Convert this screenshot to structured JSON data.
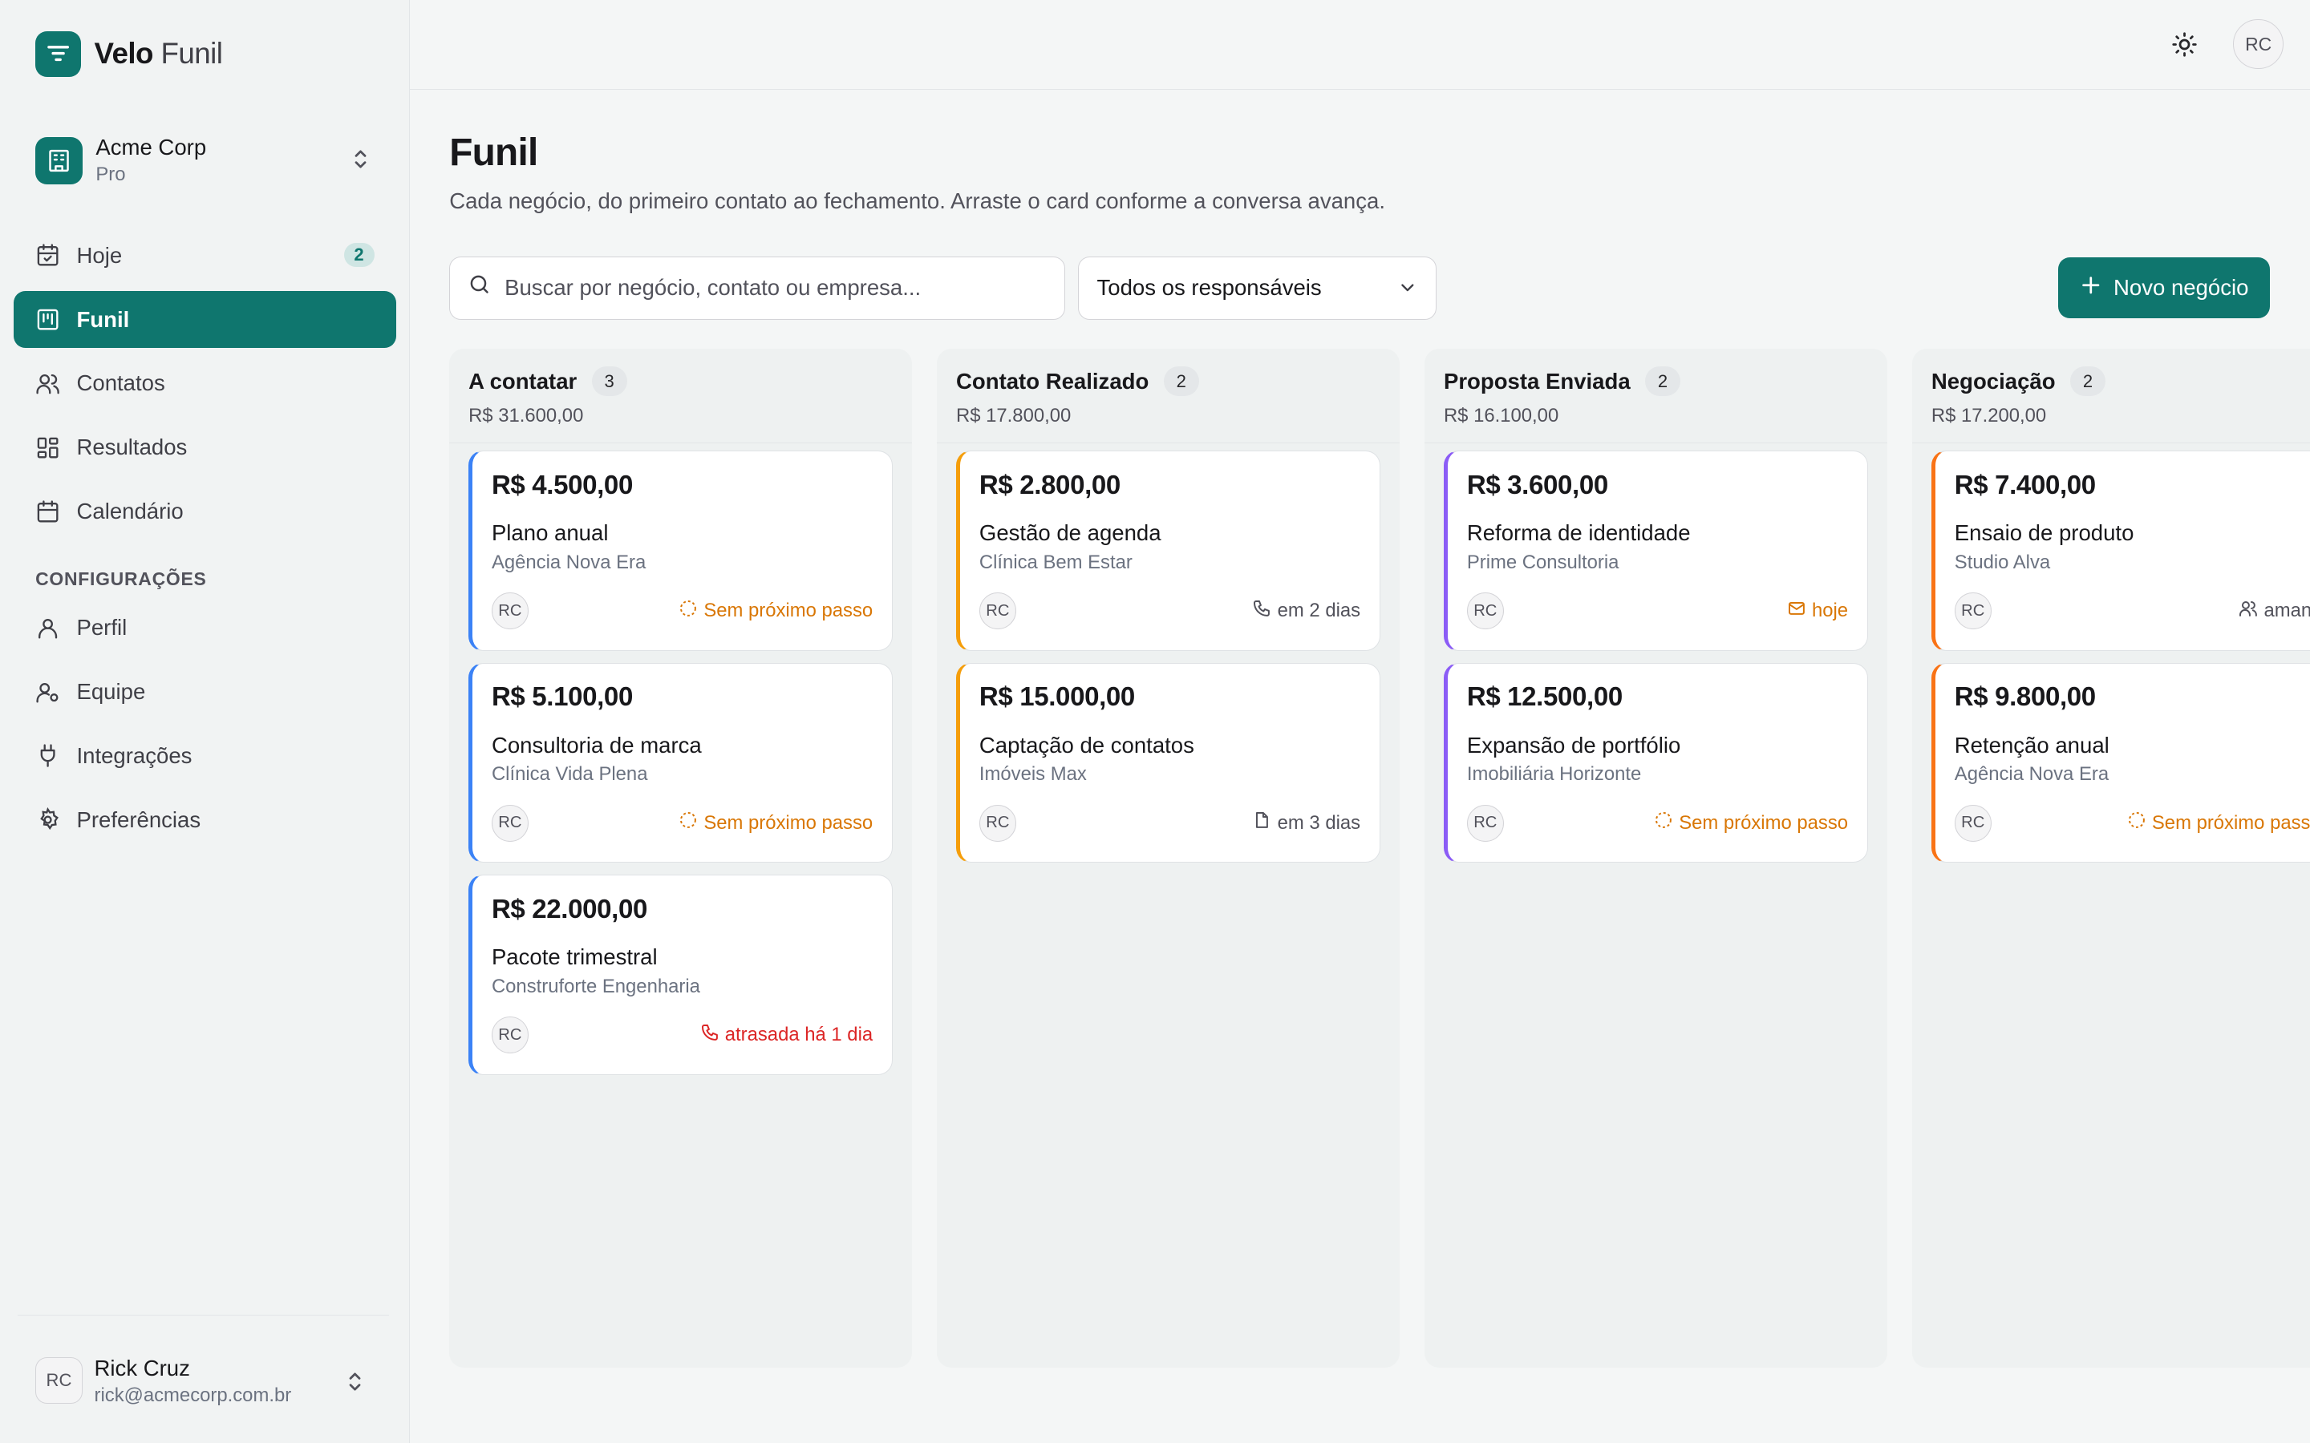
{
  "app": {
    "name_bold": "Velo",
    "name_light": "Funil"
  },
  "org": {
    "name": "Acme Corp",
    "plan": "Pro"
  },
  "nav": [
    {
      "label": "Hoje",
      "icon": "calendar-check-icon",
      "badge": "2"
    },
    {
      "label": "Funil",
      "icon": "kanban-icon",
      "active": true
    },
    {
      "label": "Contatos",
      "icon": "users-icon"
    },
    {
      "label": "Resultados",
      "icon": "dashboard-icon"
    },
    {
      "label": "Calendário",
      "icon": "calendar-icon"
    }
  ],
  "settings": {
    "label": "CONFIGURAÇÕES",
    "items": [
      {
        "label": "Perfil",
        "icon": "user-icon"
      },
      {
        "label": "Equipe",
        "icon": "team-icon"
      },
      {
        "label": "Integrações",
        "icon": "plug-icon"
      },
      {
        "label": "Preferências",
        "icon": "gear-icon"
      }
    ]
  },
  "user": {
    "initials": "RC",
    "name": "Rick Cruz",
    "email": "rick@acmecorp.com.br"
  },
  "header": {
    "avatar": "RC"
  },
  "page": {
    "title": "Funil",
    "subtitle": "Cada negócio, do primeiro contato ao fechamento. Arraste o card conforme a conversa avança."
  },
  "toolbar": {
    "search_placeholder": "Buscar por negócio, contato ou empresa...",
    "owner_filter": "Todos os responsáveis",
    "new_button": "Novo negócio"
  },
  "colors": {
    "accent": "#0f766e",
    "blue": "#3b82f6",
    "orange": "#f59e0b",
    "purple": "#8b5cf6",
    "deep_orange": "#f97316",
    "warn": "#d97706",
    "danger": "#dc2626"
  },
  "columns": [
    {
      "title": "A contatar",
      "count": "3",
      "total": "R$ 31.600,00",
      "cards": [
        {
          "value": "R$ 4.500,00",
          "name": "Plano anual",
          "company": "Agência Nova Era",
          "owner": "RC",
          "next": "Sem próximo passo",
          "next_kind": "warn",
          "next_icon": "dashed-circle-icon"
        },
        {
          "value": "R$ 5.100,00",
          "name": "Consultoria de marca",
          "company": "Clínica Vida Plena",
          "owner": "RC",
          "next": "Sem próximo passo",
          "next_kind": "warn",
          "next_icon": "dashed-circle-icon"
        },
        {
          "value": "R$ 22.000,00",
          "name": "Pacote trimestral",
          "company": "Construforte Engenharia",
          "owner": "RC",
          "next": "atrasada há 1 dia",
          "next_kind": "danger",
          "next_icon": "phone-icon"
        }
      ]
    },
    {
      "title": "Contato Realizado",
      "count": "2",
      "total": "R$ 17.800,00",
      "cards": [
        {
          "value": "R$ 2.800,00",
          "name": "Gestão de agenda",
          "company": "Clínica Bem Estar",
          "owner": "RC",
          "next": "em 2 dias",
          "next_kind": "muted",
          "next_icon": "phone-icon"
        },
        {
          "value": "R$ 15.000,00",
          "name": "Captação de contatos",
          "company": "Imóveis Max",
          "owner": "RC",
          "next": "em 3 dias",
          "next_kind": "muted",
          "next_icon": "document-icon"
        }
      ]
    },
    {
      "title": "Proposta Enviada",
      "count": "2",
      "total": "R$ 16.100,00",
      "cards": [
        {
          "value": "R$ 3.600,00",
          "name": "Reforma de identidade",
          "company": "Prime Consultoria",
          "owner": "RC",
          "next": "hoje",
          "next_kind": "warn",
          "next_icon": "mail-icon"
        },
        {
          "value": "R$ 12.500,00",
          "name": "Expansão de portfólio",
          "company": "Imobiliária Horizonte",
          "owner": "RC",
          "next": "Sem próximo passo",
          "next_kind": "warn",
          "next_icon": "dashed-circle-icon"
        }
      ]
    },
    {
      "title": "Negociação",
      "count": "2",
      "total": "R$ 17.200,00",
      "cards": [
        {
          "value": "R$ 7.400,00",
          "name": "Ensaio de produto",
          "company": "Studio Alva",
          "owner": "RC",
          "next": "amanhã",
          "next_kind": "muted",
          "next_icon": "users-icon"
        },
        {
          "value": "R$ 9.800,00",
          "name": "Retenção anual",
          "company": "Agência Nova Era",
          "owner": "RC",
          "next": "Sem próximo passo",
          "next_kind": "warn",
          "next_icon": "dashed-circle-icon"
        }
      ]
    }
  ]
}
